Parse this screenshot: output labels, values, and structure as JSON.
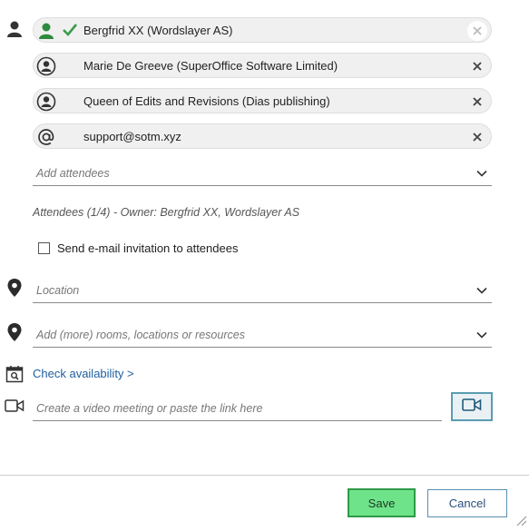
{
  "attendees": [
    {
      "name": "Bergfrid XX (Wordslayer AS)",
      "type": "user",
      "accepted": true
    },
    {
      "name": "Marie De Greeve (SuperOffice Software Limited)",
      "type": "contact"
    },
    {
      "name": "Queen of Edits and Revisions (Dias publishing)",
      "type": "contact"
    },
    {
      "name": "support@sotm.xyz",
      "type": "email"
    }
  ],
  "add_attendees_placeholder": "Add attendees",
  "attendees_info": "Attendees (1/4) - Owner: Bergfrid XX, Wordslayer AS",
  "send_invitation_label": "Send e-mail invitation to attendees",
  "send_invitation_checked": false,
  "location_placeholder": "Location",
  "resources_placeholder": "Add (more) rooms, locations or resources",
  "check_availability_label": "Check availability >",
  "video_placeholder": "Create a video meeting or paste the link here",
  "save_label": "Save",
  "cancel_label": "Cancel",
  "colors": {
    "accept_green": "#2e9b47",
    "save_bg": "#6fe38a",
    "link_blue": "#1f5fa0"
  }
}
